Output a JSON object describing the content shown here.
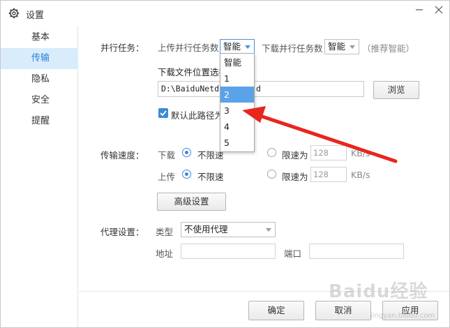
{
  "window": {
    "title": "设置"
  },
  "sidebar": {
    "items": [
      {
        "label": "基本",
        "active": false
      },
      {
        "label": "传输",
        "active": true
      },
      {
        "label": "隐私",
        "active": false
      },
      {
        "label": "安全",
        "active": false
      },
      {
        "label": "提醒",
        "active": false
      }
    ]
  },
  "parallel": {
    "section_label": "并行任务：",
    "upload_label": "上传并行任务数",
    "upload_value": "智能",
    "download_label": "下载并行任务数",
    "download_value": "智能",
    "recommend_note": "（推荐智能）",
    "dropdown_options": [
      "智能",
      "1",
      "2",
      "3",
      "4",
      "5"
    ],
    "highlighted_option": "2"
  },
  "location": {
    "label": "下载文件位置选择",
    "path_value": "D:\\BaiduNetdisk",
    "path_tail": "d",
    "browse_button": "浏览",
    "default_path_checkbox": "默认此路径为"
  },
  "speed": {
    "section_label": "传输速度：",
    "download_label": "下载",
    "upload_label": "上传",
    "unlimited_label": "不限速",
    "limit_label": "限速为",
    "download_limit_value": "128",
    "upload_limit_value": "128",
    "unit": "KB/s",
    "advanced_button": "高级设置"
  },
  "proxy": {
    "section_label": "代理设置：",
    "type_label": "类型",
    "type_value": "不使用代理",
    "address_label": "地址",
    "port_label": "端口",
    "address_value": "",
    "port_value": ""
  },
  "footer": {
    "ok_button": "确定",
    "cancel_button": "取消",
    "apply_button": "应用"
  },
  "watermark": {
    "text": "Baidu经验",
    "sub": "jingyan.baidu.com"
  },
  "colors": {
    "accent": "#3c8ad6",
    "annotation_arrow": "#e8261e",
    "active_tab_bg": "#d8ecfb"
  }
}
